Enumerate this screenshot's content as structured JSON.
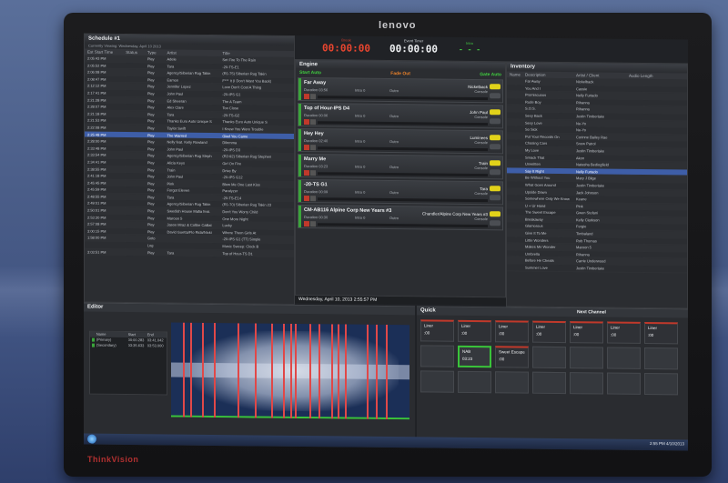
{
  "brand": {
    "top": "lenovo",
    "bottom": "ThinkVision"
  },
  "schedule": {
    "title": "Schedule #1",
    "subtitle": "Currently Viewing: Wednesday, April 10 2013",
    "columns": [
      "Est Start Time",
      "Status",
      "Type",
      "Artist",
      "Title"
    ],
    "rows": [
      {
        "time": "2:05:43 PM",
        "status": "",
        "type": "Play",
        "artist": "Adele",
        "title": "Set Fire To The Rain"
      },
      {
        "time": "2:05:52 PM",
        "status": "",
        "type": "Play",
        "artist": "Tara",
        "title": "-20-TS-E1"
      },
      {
        "time": "2:06:08 PM",
        "status": "",
        "type": "Play",
        "artist": "Agency/Siberian Rug Takin",
        "title": "(R1-75) Siberian Rug Takin"
      },
      {
        "time": "2:08:47 PM",
        "status": "",
        "type": "Play",
        "artist": "Eamon",
        "title": "F*** It (I Don't Want You Back)"
      },
      {
        "time": "2:12:12 PM",
        "status": "",
        "type": "Play",
        "artist": "Jennifer Lopez",
        "title": "Love Don't Cost A Thing"
      },
      {
        "time": "2:17:41 PM",
        "status": "",
        "type": "Play",
        "artist": "John Paul",
        "title": "-20-IPS G1"
      },
      {
        "time": "2:21:28 PM",
        "status": "",
        "type": "Play",
        "artist": "Ed Sheeran",
        "title": "The A Team"
      },
      {
        "time": "2:28:07 PM",
        "status": "",
        "type": "Play",
        "artist": "Alex Clare",
        "title": "Too Close"
      },
      {
        "time": "2:21:18 PM",
        "status": "",
        "type": "Play",
        "artist": "Tara",
        "title": "-20-TS-G2"
      },
      {
        "time": "2:21:53 PM",
        "status": "",
        "type": "Play",
        "artist": "Thanks Euro Auto Unique S",
        "title": "Thanks Euro Auto Unique S"
      },
      {
        "time": "2:22:08 PM",
        "status": "",
        "type": "Play",
        "artist": "Taylor Swift",
        "title": "I Knew You Were Trouble"
      },
      {
        "time": "2:25:48 PM",
        "status": "",
        "type": "Play",
        "artist": "The Wanted",
        "title": "Glad You Came"
      },
      {
        "time": "2:28:00 PM",
        "status": "",
        "type": "Play",
        "artist": "Nelly feat. Kelly Rowland",
        "title": "Dilemma"
      },
      {
        "time": "2:33:48 PM",
        "status": "",
        "type": "Play",
        "artist": "John Paul",
        "title": "-20-IPS D3"
      },
      {
        "time": "2:33:54 PM",
        "status": "",
        "type": "Play",
        "artist": "Agency/Siberian Rug Steph",
        "title": "(R2-92) Siberian Rug Stephen"
      },
      {
        "time": "2:34:41 PM",
        "status": "",
        "type": "Play",
        "artist": "Alicia Keys",
        "title": "Girl On Fire"
      },
      {
        "time": "2:38:55 PM",
        "status": "",
        "type": "Play",
        "artist": "Train",
        "title": "Drive By"
      },
      {
        "time": "2:41:18 PM",
        "status": "",
        "type": "Play",
        "artist": "John Paul",
        "title": "-20-IPS G12"
      },
      {
        "time": "2:45:45 PM",
        "status": "",
        "type": "Play",
        "artist": "Pink",
        "title": "Blow Me One Last Kiss"
      },
      {
        "time": "2:45:59 PM",
        "status": "",
        "type": "Play",
        "artist": "Forgot Eleven",
        "title": "Paralyzer"
      },
      {
        "time": "2:48:55 PM",
        "status": "",
        "type": "Play",
        "artist": "Tara",
        "title": "-20-TS-E14"
      },
      {
        "time": "2:49:01 PM",
        "status": "",
        "type": "Play",
        "artist": "Agency/Siberian Rug Takin",
        "title": "(R1-70) Siberian Rug Takin 23"
      },
      {
        "time": "2:50:01 PM",
        "status": "",
        "type": "Play",
        "artist": "Swedish House Mafia feat.",
        "title": "Don't You Worry Child"
      },
      {
        "time": "2:53:30 PM",
        "status": "",
        "type": "Play",
        "artist": "Maroon 5",
        "title": "One More Night"
      },
      {
        "time": "2:57:08 PM",
        "status": "",
        "type": "Play",
        "artist": "Jason Mraz & Colbie Caillat",
        "title": "Lucky"
      },
      {
        "time": "3:00:15 PM",
        "status": "",
        "type": "Play",
        "artist": "David Guetta/Flo Rida/Nicki",
        "title": "Where Them Girls At"
      },
      {
        "time": "1:58:00 PM",
        "status": "",
        "type": "Goto",
        "artist": "",
        "title": "-20-IPS G1 (TT) Simple"
      },
      {
        "time": "",
        "status": "",
        "type": "Log",
        "artist": "",
        "title": "Music Sweep: Clock B"
      },
      {
        "time": "3:03:51 PM",
        "status": "",
        "type": "Play",
        "artist": "Tara",
        "title": "Top of Hour-TS D1"
      }
    ],
    "selected_index": 11
  },
  "timers": {
    "break": {
      "label": "Break",
      "value": "00:00:00"
    },
    "event": {
      "label": "Event Timer",
      "value": "00:00:00"
    },
    "intro": {
      "label": "Intro",
      "value": "- - -"
    }
  },
  "engine": {
    "title": "Engine",
    "start_auto": "Start Auto",
    "fade_out": "Fade Out",
    "gate_auto": "Gate Auto",
    "carts": [
      {
        "title": "Far Away",
        "artist": "Nickelback",
        "duration": "Duration 03:56",
        "intro": "Intro 0",
        "outro": "Outro",
        "category": "Console"
      },
      {
        "title": "Top of Hour-IPS D4",
        "artist": "John Paul",
        "duration": "Duration 00:06",
        "intro": "Intro 0",
        "outro": "Outro",
        "category": "Console"
      },
      {
        "title": "Hey Hey",
        "artist": "Luminees",
        "duration": "Duration 02:40",
        "intro": "Intro 0",
        "outro": "Outro",
        "category": "Console"
      },
      {
        "title": "Marry Me",
        "artist": "Train",
        "duration": "Duration 03:23",
        "intro": "Intro 0",
        "outro": "Outro",
        "category": "Console"
      },
      {
        "title": "-20-TS G1",
        "artist": "Tara",
        "duration": "Duration 00:09",
        "intro": "Intro 0",
        "outro": "Outro",
        "category": "Console"
      },
      {
        "title": "CM-AB116 Alpine Corp New Years #3",
        "artist": "Chandler/Alpine Corp New Years #3",
        "duration": "Duration 00:30",
        "intro": "Intro 0",
        "outro": "Outro",
        "category": "Console"
      }
    ],
    "datetime": "Wednesday, April 10, 2013 2:55:57 PM"
  },
  "inventory": {
    "title": "Inventory",
    "columns": [
      "Name",
      "Description",
      "Artist / Client",
      "Audio Length"
    ],
    "rows": [
      {
        "name": "",
        "desc": "Far Away",
        "artist": "Nickelback",
        "len": ""
      },
      {
        "name": "",
        "desc": "You And I",
        "artist": "Cassie",
        "len": ""
      },
      {
        "name": "",
        "desc": "Promiscuous",
        "artist": "Nelly Furtado",
        "len": ""
      },
      {
        "name": "",
        "desc": "Rude Boy",
        "artist": "Rihanna",
        "len": ""
      },
      {
        "name": "",
        "desc": "S.O.S.",
        "artist": "Rihanna",
        "len": ""
      },
      {
        "name": "",
        "desc": "Sexy Back",
        "artist": "Justin Timberlake",
        "len": ""
      },
      {
        "name": "",
        "desc": "Sexy Love",
        "artist": "Ne-Yo",
        "len": ""
      },
      {
        "name": "",
        "desc": "So Sick",
        "artist": "Ne-Yo",
        "len": ""
      },
      {
        "name": "",
        "desc": "Put Your Records On",
        "artist": "Corinne Bailey Rae",
        "len": ""
      },
      {
        "name": "",
        "desc": "Chasing Cars",
        "artist": "Snow Patrol",
        "len": ""
      },
      {
        "name": "",
        "desc": "My Love",
        "artist": "Justin Timberlake",
        "len": ""
      },
      {
        "name": "",
        "desc": "Smack That",
        "artist": "Akon",
        "len": ""
      },
      {
        "name": "",
        "desc": "Unwritten",
        "artist": "Natasha Bedingfield",
        "len": ""
      },
      {
        "name": "",
        "desc": "Say It Right",
        "artist": "Nelly Furtado",
        "len": ""
      },
      {
        "name": "",
        "desc": "Be Without You",
        "artist": "Mary J Blige",
        "len": ""
      },
      {
        "name": "",
        "desc": "What Goes Around",
        "artist": "Justin Timberlake",
        "len": ""
      },
      {
        "name": "",
        "desc": "Upside Down",
        "artist": "Jack Johnson",
        "len": ""
      },
      {
        "name": "",
        "desc": "Somewhere Only We Know",
        "artist": "Keane",
        "len": ""
      },
      {
        "name": "",
        "desc": "U + Ur Hand",
        "artist": "Pink",
        "len": ""
      },
      {
        "name": "",
        "desc": "The Sweet Escape",
        "artist": "Gwen Stefani",
        "len": ""
      },
      {
        "name": "",
        "desc": "Breakaway",
        "artist": "Kelly Clarkson",
        "len": ""
      },
      {
        "name": "",
        "desc": "Glamorous",
        "artist": "Fergie",
        "len": ""
      },
      {
        "name": "",
        "desc": "Give It To Me",
        "artist": "Timbaland",
        "len": ""
      },
      {
        "name": "",
        "desc": "Little Wonders",
        "artist": "Rob Thomas",
        "len": ""
      },
      {
        "name": "",
        "desc": "Makes Me Wonder",
        "artist": "Maroon 5",
        "len": ""
      },
      {
        "name": "",
        "desc": "Umbrella",
        "artist": "Rihanna",
        "len": ""
      },
      {
        "name": "",
        "desc": "Before He Cheats",
        "artist": "Carrie Underwood",
        "len": ""
      },
      {
        "name": "",
        "desc": "Summer Love",
        "artist": "Justin Timberlake",
        "len": ""
      }
    ],
    "selected_index": 13
  },
  "editor": {
    "title": "Editor",
    "marker_columns": [
      "Name",
      "Start",
      "End"
    ],
    "markers": [
      {
        "name": "(Primary)",
        "start": "00:00.283",
        "end": "03:41.042"
      },
      {
        "name": "(Secondary)",
        "start": "03:35.633",
        "end": "03:53.000"
      }
    ],
    "marker_positions": [
      0.05,
      0.08,
      0.13,
      0.18,
      0.28,
      0.35,
      0.42,
      0.47,
      0.5,
      0.52,
      0.58,
      0.62,
      0.67,
      0.7,
      0.73,
      0.82,
      0.86,
      0.9
    ]
  },
  "quick": {
    "title": "Quick",
    "next_channel": "Next Channel",
    "cells": [
      {
        "label": "Liner",
        "value": ":00",
        "state": "on"
      },
      {
        "label": "Liner",
        "value": ":00",
        "state": "on"
      },
      {
        "label": "Liner",
        "value": ":00",
        "state": "on"
      },
      {
        "label": "Liner",
        "value": ":00",
        "state": "on"
      },
      {
        "label": "Liner",
        "value": ":00",
        "state": "on"
      },
      {
        "label": "Liner",
        "value": ":00",
        "state": "on"
      },
      {
        "label": "Liner",
        "value": ":00",
        "state": "on"
      },
      {
        "label": "",
        "value": "",
        "state": ""
      },
      {
        "label": "NAB",
        "value": "03:23",
        "state": "green"
      },
      {
        "label": "Sweet Escape",
        "value": ":00",
        "state": "on"
      },
      {
        "label": "",
        "value": "",
        "state": ""
      },
      {
        "label": "",
        "value": "",
        "state": ""
      },
      {
        "label": "",
        "value": "",
        "state": ""
      },
      {
        "label": "",
        "value": "",
        "state": ""
      },
      {
        "label": "",
        "value": "",
        "state": ""
      },
      {
        "label": "",
        "value": "",
        "state": ""
      },
      {
        "label": "",
        "value": "",
        "state": ""
      },
      {
        "label": "",
        "value": "",
        "state": ""
      },
      {
        "label": "",
        "value": "",
        "state": ""
      },
      {
        "label": "",
        "value": "",
        "state": ""
      },
      {
        "label": "",
        "value": "",
        "state": ""
      }
    ]
  },
  "taskbar": {
    "time": "2:55 PM",
    "date": "4/10/2013"
  },
  "colors": {
    "accent": "#3e5ea8",
    "timer_red": "#e8452f",
    "green": "#3ac43a",
    "marker_red": "#e04848",
    "cart_tag": "#e1d21a"
  }
}
